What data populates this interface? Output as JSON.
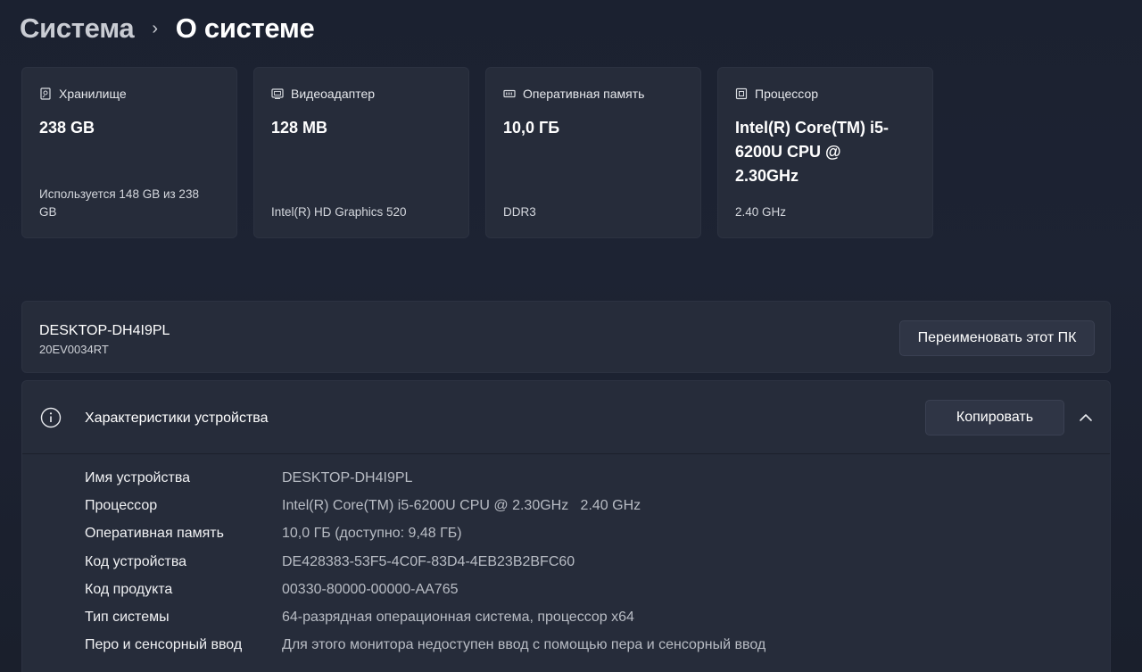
{
  "breadcrumb": {
    "parent": "Система",
    "separator": "›",
    "current": "О системе"
  },
  "cards": [
    {
      "icon": "storage-icon",
      "title": "Хранилище",
      "value": "238 GB",
      "sub": "Используется 148 GB из 238 GB"
    },
    {
      "icon": "display-adapter-icon",
      "title": "Видеоадаптер",
      "value": "128 MB",
      "sub": "Intel(R) HD Graphics 520"
    },
    {
      "icon": "memory-icon",
      "title": "Оперативная память",
      "value": "10,0 ГБ",
      "sub": "DDR3"
    },
    {
      "icon": "processor-icon",
      "title": "Процессор",
      "value": "Intel(R) Core(TM) i5-6200U CPU @ 2.30GHz",
      "sub": "2.40 GHz"
    }
  ],
  "device": {
    "name": "DESKTOP-DH4I9PL",
    "model": "20EV0034RT",
    "rename_label": "Переименовать этот ПК"
  },
  "specs": {
    "title": "Характеристики устройства",
    "copy_label": "Копировать",
    "rows": [
      {
        "label": "Имя устройства",
        "value": "DESKTOP-DH4I9PL"
      },
      {
        "label": "Процессор",
        "value": "Intel(R) Core(TM) i5-6200U CPU @ 2.30GHz   2.40 GHz"
      },
      {
        "label": "Оперативная память",
        "value": "10,0 ГБ (доступно: 9,48 ГБ)"
      },
      {
        "label": "Код устройства",
        "value": "DE428383-53F5-4C0F-83D4-4EB23B2BFC60"
      },
      {
        "label": "Код продукта",
        "value": "00330-80000-00000-AA765"
      },
      {
        "label": "Тип системы",
        "value": "64-разрядная операционная система, процессор x64"
      },
      {
        "label": "Перо и сенсорный ввод",
        "value": "Для этого монитора недоступен ввод с помощью пера и сенсорный ввод"
      }
    ]
  },
  "colors": {
    "background": "#1c2230",
    "panel": "#262c3a",
    "button": "#2f3545",
    "muted_text": "#b8bcc4"
  }
}
